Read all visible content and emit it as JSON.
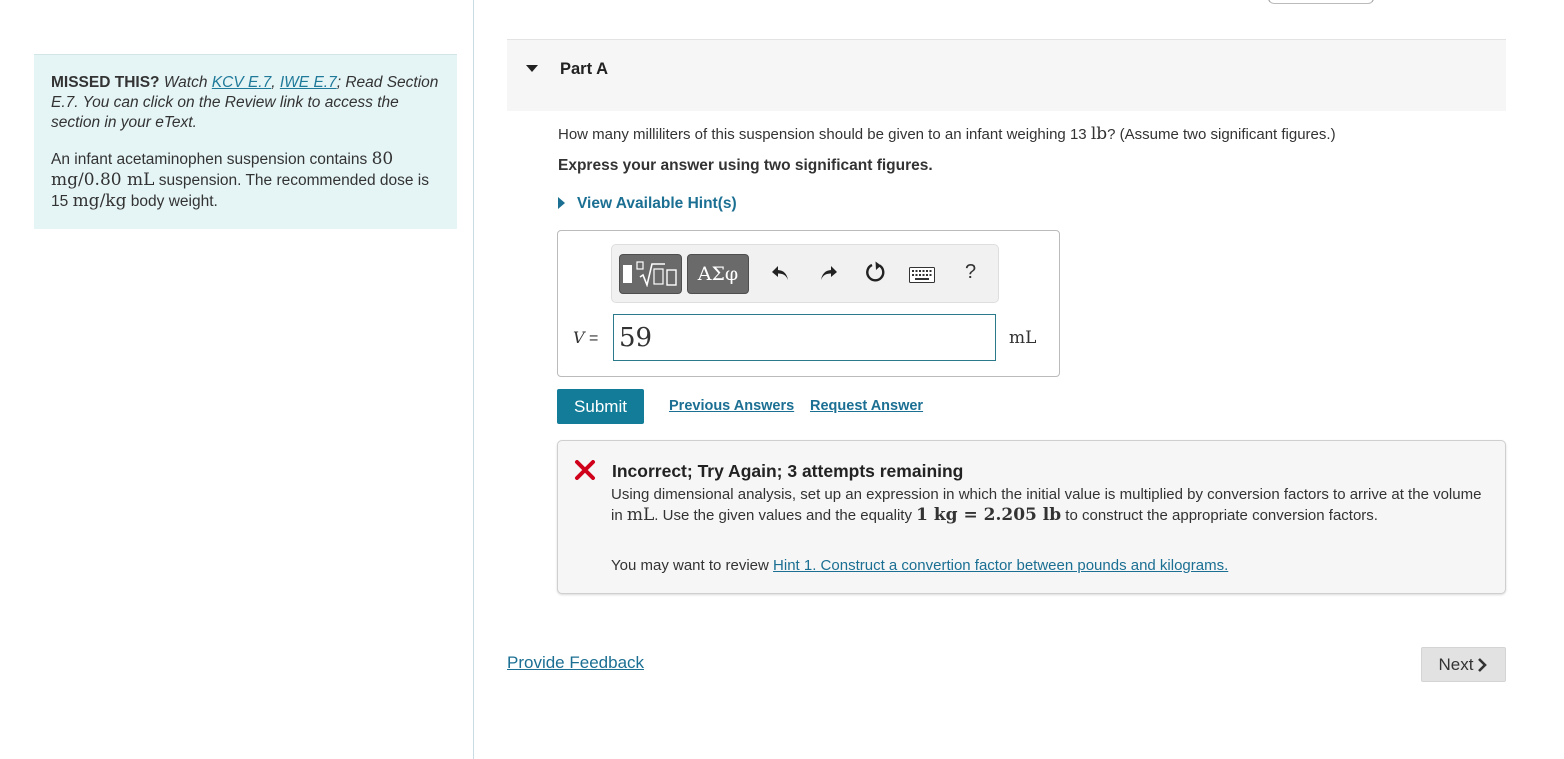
{
  "intro": {
    "missed_label": "MISSED THIS?",
    "watch_text": "Watch",
    "link_kcv": "KCV E.7",
    "sep_comma": ",",
    "link_iwe": "IWE E.7",
    "rest_text": "; Read Section E.7. You can click on the Review link to access the section in your eText.",
    "problem_pre": "An infant acetaminophen suspension contains",
    "problem_qty": "80 mg/0.80 mL",
    "problem_mid": "suspension. The recommended dose is 15",
    "problem_unit": "mg/kg",
    "problem_post": "body weight."
  },
  "part": {
    "title": "Part A",
    "question_pre": "How many milliliters of this suspension should be given to an infant weighing 13",
    "question_unit": "lb",
    "question_post": "? (Assume two significant figures.)",
    "express": "Express your answer using two significant figures.",
    "hints_label": "View Available Hint(s)"
  },
  "answer": {
    "greek_label": "ΑΣφ",
    "help_label": "?",
    "variable": "V",
    "equals": "=",
    "value": "59",
    "unit": "mL"
  },
  "actions": {
    "submit_label": "Submit",
    "previous_answers": "Previous Answers",
    "request_answer": "Request Answer"
  },
  "feedback": {
    "title": "Incorrect; Try Again; 3 attempts remaining",
    "body_pre": "Using dimensional analysis, set up an expression in which the initial value is multiplied by conversion factors to arrive at the volume in",
    "body_unit": "mL",
    "body_mid": ". Use the given values and the equality",
    "body_eq": "1 kg = 2.205 lb",
    "body_post": "to construct the appropriate conversion factors.",
    "review_pre": "You may want to review",
    "review_link": "Hint 1. Construct a convertion factor between pounds and kilograms."
  },
  "footer": {
    "provide_feedback": "Provide Feedback",
    "next_label": "Next"
  },
  "colors": {
    "link": "#1b6f93",
    "submit_bg": "#137c99",
    "intro_bg": "#e5f4f5",
    "error": "#d0021b"
  }
}
